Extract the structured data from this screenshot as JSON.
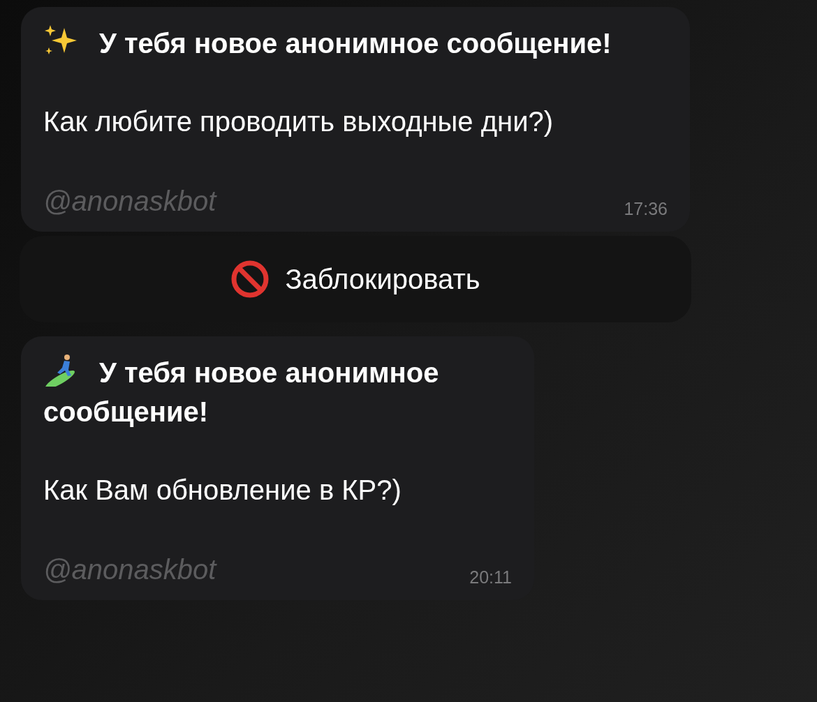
{
  "messages": [
    {
      "title": "У тебя новое анонимное сообщение!",
      "question": "Как любите проводить выходные дни?)",
      "via": "@anonaskbot",
      "time": "17:36",
      "button": {
        "label": "Заблокировать"
      }
    },
    {
      "title": "У тебя новое анонимное сообщение!",
      "question": "Как Вам обновление в КР?)",
      "via": "@anonaskbot",
      "time": "20:11"
    }
  ]
}
